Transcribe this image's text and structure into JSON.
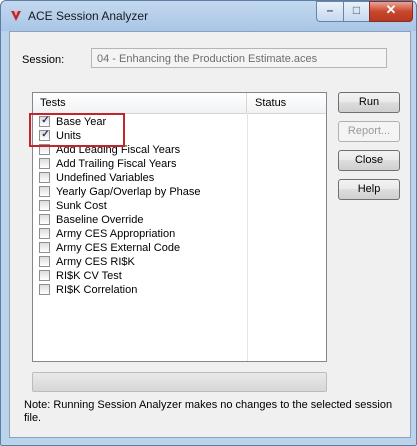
{
  "window": {
    "title": "ACE Session Analyzer",
    "controls": {
      "minimize": "–",
      "maximize": "□",
      "close": "✕"
    }
  },
  "session": {
    "label": "Session:",
    "value": "04 - Enhancing the Production Estimate.aces"
  },
  "tests_list": {
    "columns": {
      "tests": "Tests",
      "status": "Status"
    },
    "items": [
      {
        "label": "Base Year",
        "checked": true
      },
      {
        "label": "Units",
        "checked": true
      },
      {
        "label": "Add Leading Fiscal Years",
        "checked": false
      },
      {
        "label": "Add Trailing Fiscal Years",
        "checked": false
      },
      {
        "label": "Undefined Variables",
        "checked": false
      },
      {
        "label": "Yearly Gap/Overlap by Phase",
        "checked": false
      },
      {
        "label": "Sunk Cost",
        "checked": false
      },
      {
        "label": "Baseline Override",
        "checked": false
      },
      {
        "label": "Army CES Appropriation",
        "checked": false
      },
      {
        "label": "Army CES External Code",
        "checked": false
      },
      {
        "label": "Army CES RI$K",
        "checked": false
      },
      {
        "label": "RI$K CV Test",
        "checked": false
      },
      {
        "label": "RI$K Correlation",
        "checked": false
      }
    ]
  },
  "buttons": {
    "run": "Run",
    "report": "Report...",
    "close": "Close",
    "help": "Help"
  },
  "note": "Note: Running Session Analyzer makes no changes to the selected session file.",
  "colors": {
    "highlight": "#c0262b",
    "app_icon": "#c0262b"
  }
}
